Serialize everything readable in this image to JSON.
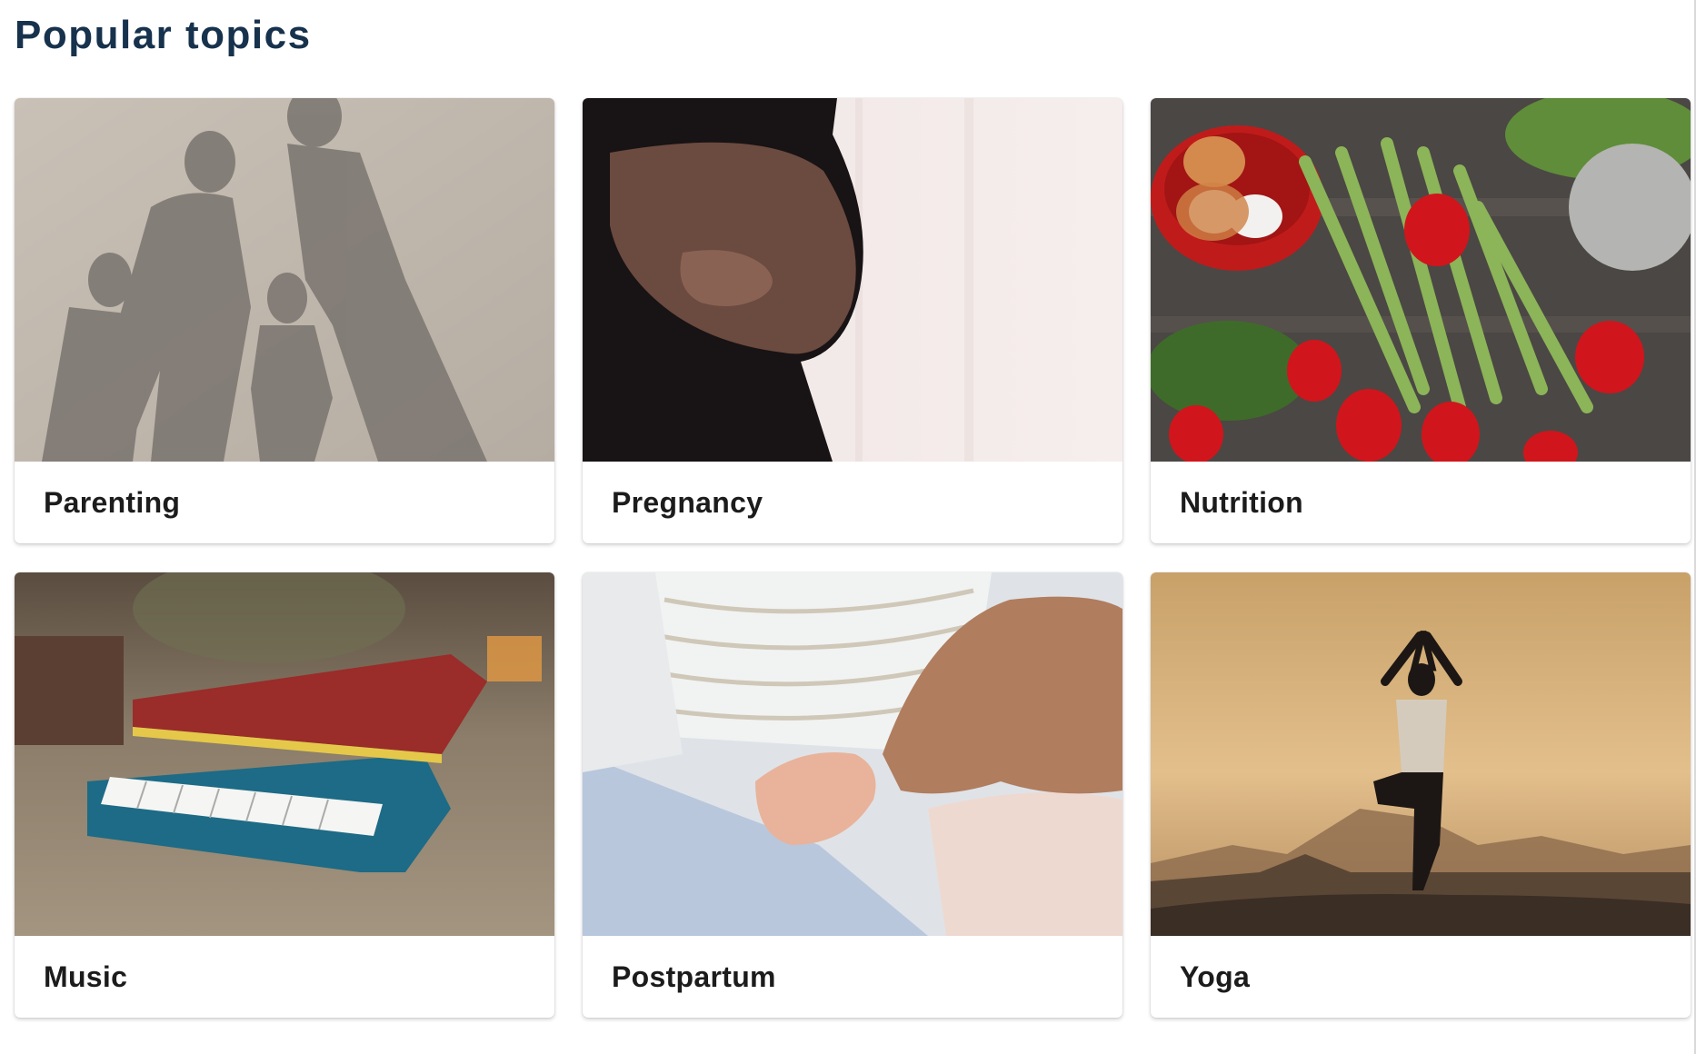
{
  "section": {
    "title": "Popular topics"
  },
  "topics": [
    {
      "label": "Parenting",
      "image": "family-shadow-on-sand"
    },
    {
      "label": "Pregnancy",
      "image": "pregnant-belly-silhouette"
    },
    {
      "label": "Nutrition",
      "image": "eggs-asparagus-strawberries"
    },
    {
      "label": "Music",
      "image": "toy-piano"
    },
    {
      "label": "Postpartum",
      "image": "newborn-hand-holding-finger"
    },
    {
      "label": "Yoga",
      "image": "yoga-tree-pose-desert"
    }
  ]
}
